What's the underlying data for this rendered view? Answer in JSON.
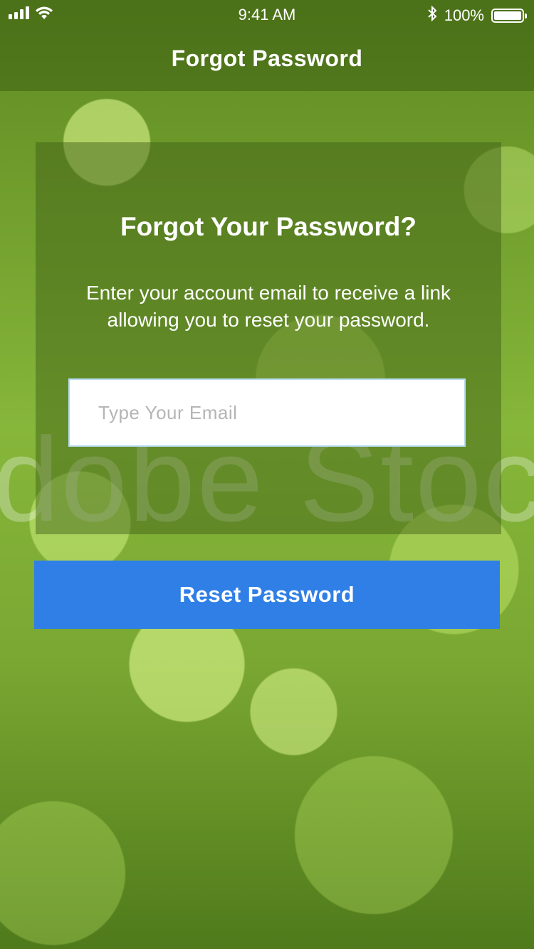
{
  "status_bar": {
    "time": "9:41 AM",
    "battery": "100%",
    "icons": [
      "signal-icon",
      "wifi-icon",
      "bluetooth-icon",
      "battery-icon"
    ]
  },
  "nav": {
    "title": "Forgot Password"
  },
  "form": {
    "heading": "Forgot Your Password?",
    "description": "Enter your account email to receive a link allowing you to reset your password.",
    "email_value": "",
    "email_placeholder": "Type Your Email",
    "submit_label": "Reset Password"
  },
  "watermark": "dobe Stock",
  "colors": {
    "button": "#2f7fe6",
    "input_border": "#b8dcf2"
  }
}
